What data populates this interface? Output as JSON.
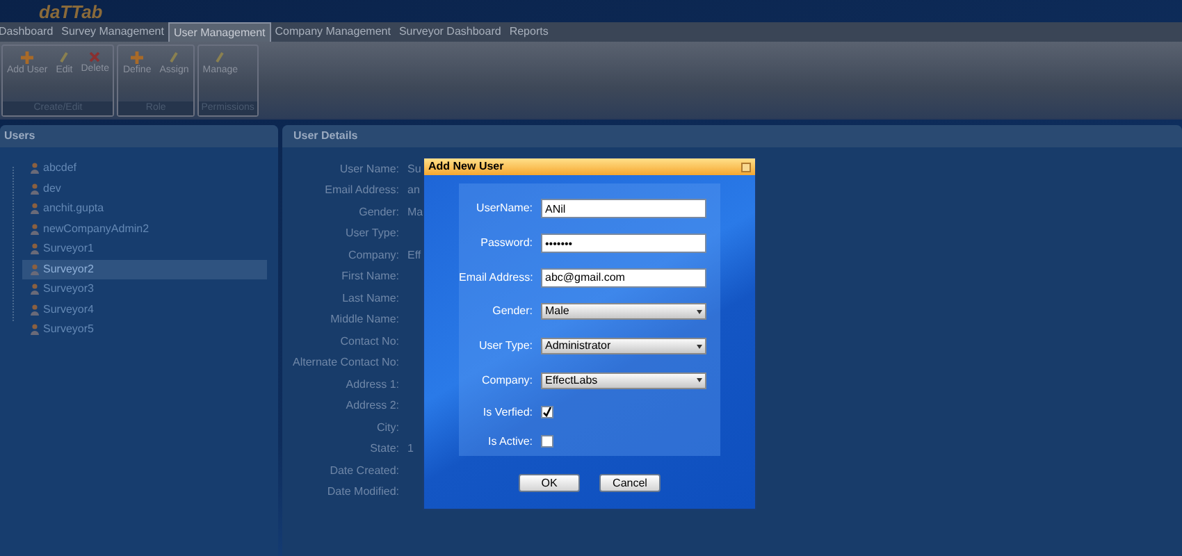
{
  "app": {
    "logo": "daTTab"
  },
  "menu": [
    {
      "label": "Dashboard",
      "selected": false
    },
    {
      "label": "Survey Management",
      "selected": false
    },
    {
      "label": "User Management",
      "selected": true
    },
    {
      "label": "Company Management",
      "selected": false
    },
    {
      "label": "Surveyor Dashboard",
      "selected": false
    },
    {
      "label": "Reports",
      "selected": false
    }
  ],
  "ribbon": [
    {
      "label": "Create/Edit",
      "buttons": [
        {
          "label": "Add User",
          "kind": "add"
        },
        {
          "label": "Edit",
          "kind": "edit"
        },
        {
          "label": "Delete",
          "kind": "delete"
        }
      ]
    },
    {
      "label": "Role",
      "buttons": [
        {
          "label": "Define",
          "kind": "add"
        },
        {
          "label": "Assign",
          "kind": "edit"
        }
      ]
    },
    {
      "label": "Permissions",
      "buttons": [
        {
          "label": "Manage",
          "kind": "edit"
        }
      ]
    }
  ],
  "users_panel": {
    "title": "Users",
    "items": [
      {
        "label": "abcdef",
        "selected": false
      },
      {
        "label": "dev",
        "selected": false
      },
      {
        "label": "anchit.gupta",
        "selected": false
      },
      {
        "label": "newCompanyAdmin2",
        "selected": false
      },
      {
        "label": "Surveyor1",
        "selected": false
      },
      {
        "label": "Surveyor2",
        "selected": true
      },
      {
        "label": "Surveyor3",
        "selected": false
      },
      {
        "label": "Surveyor4",
        "selected": false
      },
      {
        "label": "Surveyor5",
        "selected": false
      }
    ]
  },
  "details_panel": {
    "title": "User Details",
    "fields": [
      {
        "label": "User Name:",
        "value": "Su"
      },
      {
        "label": "Email Address:",
        "value": "an"
      },
      {
        "label": "Gender:",
        "value": "Ma"
      },
      {
        "label": "User Type:"
      },
      {
        "label": "Company:",
        "value": "Eff"
      },
      {
        "label": "First Name:"
      },
      {
        "label": "Last Name:"
      },
      {
        "label": "Middle Name:"
      },
      {
        "label": "Contact No:"
      },
      {
        "label": "Alternate Contact No:"
      },
      {
        "label": "Address 1:"
      },
      {
        "label": "Address 2:"
      },
      {
        "label": "City:"
      },
      {
        "label": "State:",
        "value": "1"
      },
      {
        "label": "Date Created:"
      },
      {
        "label": "Date Modified:"
      }
    ]
  },
  "dialog": {
    "title": "Add New User",
    "fields": [
      {
        "kind": "text",
        "label": "UserName:",
        "value": "ANil"
      },
      {
        "kind": "text",
        "label": "Password:",
        "value": "•••••••"
      },
      {
        "kind": "text",
        "label": "Email Address:",
        "value": "abc@gmail.com"
      },
      {
        "kind": "select",
        "label": "Gender:",
        "value": "Male"
      },
      {
        "kind": "select",
        "label": "User Type:",
        "value": "Administrator"
      },
      {
        "kind": "select",
        "label": "Company:",
        "value": "EffectLabs"
      },
      {
        "kind": "checkbox",
        "label": "Is Verfied:",
        "checked": true
      },
      {
        "kind": "checkbox",
        "label": "Is Active:",
        "checked": false
      }
    ],
    "buttons": [
      "OK",
      "Cancel"
    ]
  }
}
